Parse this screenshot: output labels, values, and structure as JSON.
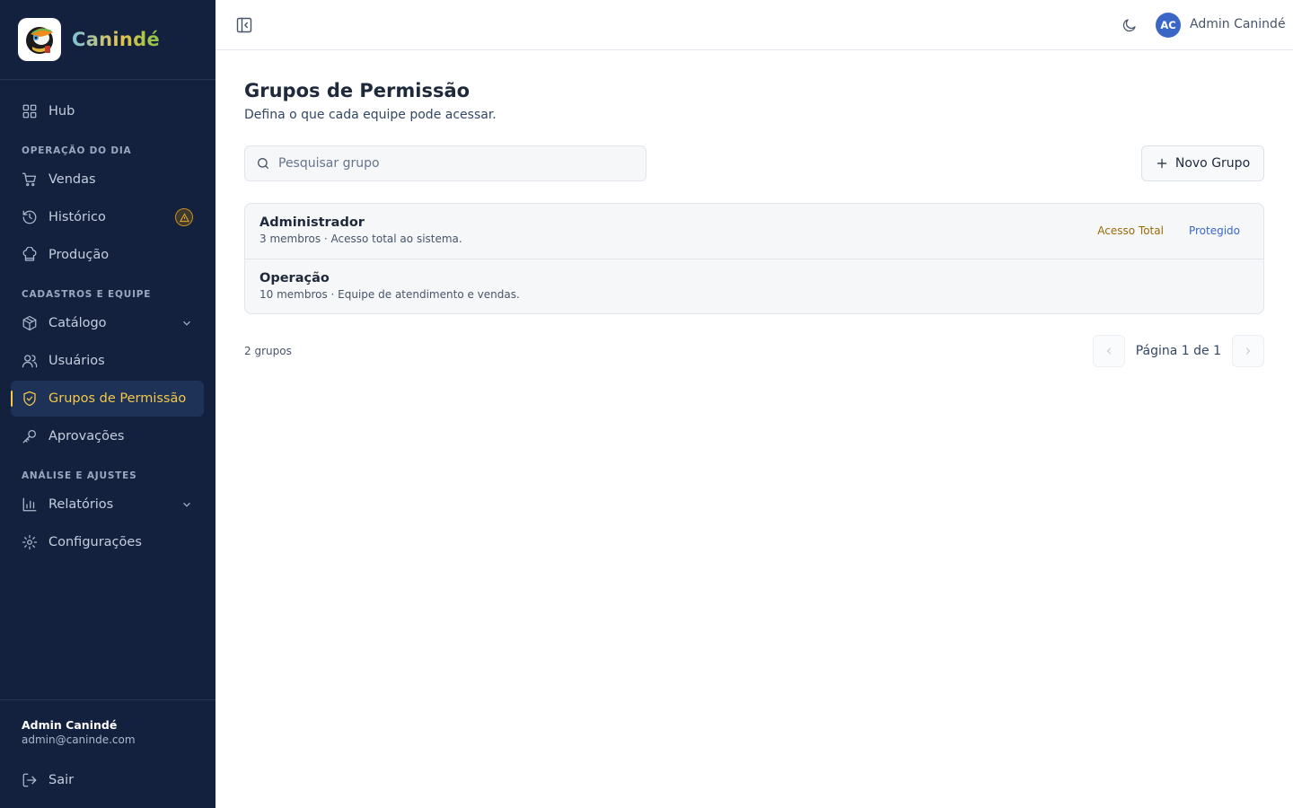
{
  "brand": {
    "name": "Canindé"
  },
  "sidebar": {
    "hub": "Hub",
    "sections": {
      "daily": "OPERAÇÃO DO DIA",
      "registry": "CADASTROS E EQUIPE",
      "analysis": "ANÁLISE E AJUSTES"
    },
    "items": {
      "vendas": "Vendas",
      "historico": "Histórico",
      "producao": "Produção",
      "catalogo": "Catálogo",
      "usuarios": "Usuários",
      "grupos": "Grupos de Permissão",
      "aprovacoes": "Aprovações",
      "relatorios": "Relatórios",
      "configuracoes": "Configurações"
    },
    "active_item": "Grupos de Permissão",
    "footer": {
      "user_name": "Admin Canindé",
      "user_email": "admin@caninde.com",
      "logout": "Sair"
    }
  },
  "topbar": {
    "avatar_initials": "AC",
    "user_name": "Admin Canindé"
  },
  "page": {
    "title": "Grupos de Permissão",
    "subtitle": "Defina o que cada equipe pode acessar.",
    "search_placeholder": "Pesquisar grupo",
    "new_button": "Novo Grupo"
  },
  "groups": [
    {
      "name": "Administrador",
      "description": "3 membros · Acesso total ao sistema.",
      "badges": [
        "Acesso Total",
        "Protegido"
      ]
    },
    {
      "name": "Operação",
      "description": "10 membros · Equipe de atendimento e vendas.",
      "badges": []
    }
  ],
  "footer": {
    "count": "2 grupos",
    "pagination": "Página 1 de 1"
  },
  "colors": {
    "sidebar_bg": "#13213f",
    "accent": "#f4c84a",
    "avatar": "#3a67c7",
    "badge_full": "#9a6a06",
    "badge_protected": "#3a67c7"
  },
  "icons": {
    "hub": "grid-icon",
    "vendas": "cart-icon",
    "historico": "history-icon",
    "producao": "chef-hat-icon",
    "catalogo": "box-icon",
    "usuarios": "users-icon",
    "grupos": "shield-check-icon",
    "aprovacoes": "key-icon",
    "relatorios": "bar-chart-icon",
    "configuracoes": "gear-icon",
    "logout": "logout-icon"
  }
}
